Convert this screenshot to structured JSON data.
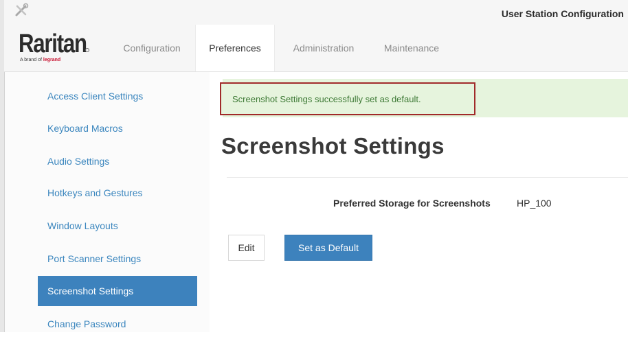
{
  "header": {
    "app_title": "User Station Configuration",
    "tools_icon": "tools-icon",
    "logo": {
      "wordmark": "Raritan",
      "tagline_prefix": "A brand of",
      "tagline_brand": "legrand",
      "brand_color": "#c8102e"
    },
    "tabs": [
      {
        "label": "Configuration",
        "active": false
      },
      {
        "label": "Preferences",
        "active": true
      },
      {
        "label": "Administration",
        "active": false
      },
      {
        "label": "Maintenance",
        "active": false
      }
    ]
  },
  "sidebar": {
    "items": [
      {
        "label": "Access Client Settings",
        "active": false
      },
      {
        "label": "Keyboard Macros",
        "active": false
      },
      {
        "label": "Audio Settings",
        "active": false
      },
      {
        "label": "Hotkeys and Gestures",
        "active": false
      },
      {
        "label": "Window Layouts",
        "active": false
      },
      {
        "label": "Port Scanner Settings",
        "active": false
      },
      {
        "label": "Screenshot Settings",
        "active": true
      },
      {
        "label": "Change Password",
        "active": false
      }
    ]
  },
  "main": {
    "alert": "Screenshot Settings successfully set as default.",
    "title": "Screenshot Settings",
    "fields": [
      {
        "label": "Preferred Storage for Screenshots",
        "value": "HP_100"
      }
    ],
    "buttons": {
      "edit_label": "Edit",
      "set_default_label": "Set as Default"
    }
  },
  "colors": {
    "accent": "#3d82bd",
    "link": "#3b86be",
    "alert_bg": "#e6f4dd",
    "alert_text": "#3e7a36",
    "alert_border": "#a12a2a"
  }
}
